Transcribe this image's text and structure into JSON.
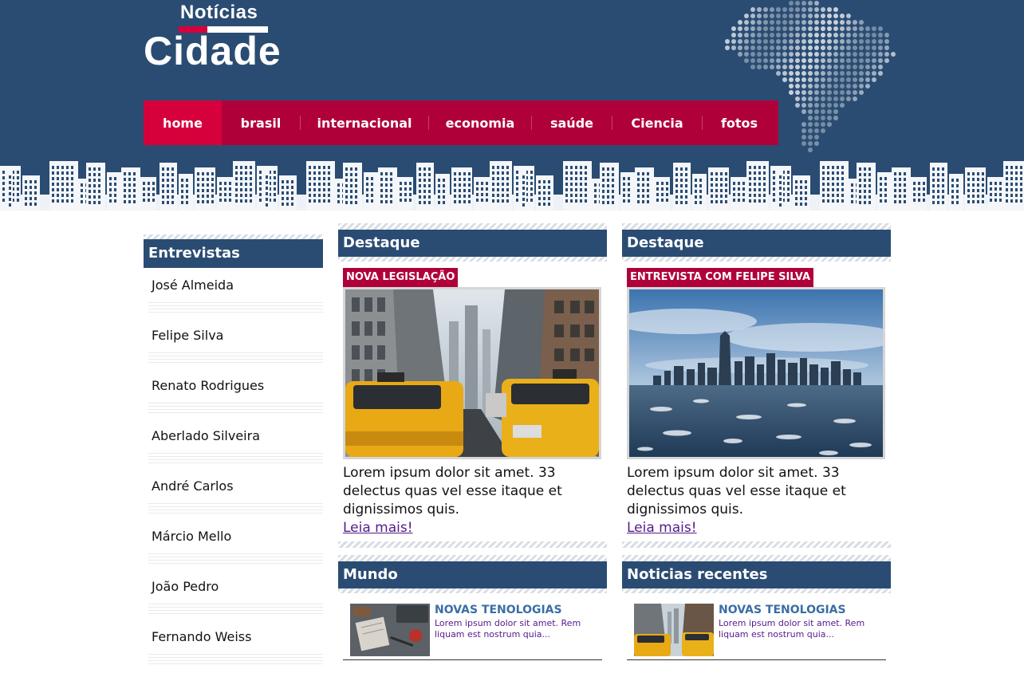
{
  "logo": {
    "top": "Notícias",
    "main": "Cidade"
  },
  "nav": [
    {
      "label": "home",
      "active": true
    },
    {
      "label": "brasil"
    },
    {
      "label": "internacional"
    },
    {
      "label": "economia"
    },
    {
      "label": "saúde"
    },
    {
      "label": "Ciencia"
    },
    {
      "label": "fotos"
    }
  ],
  "sidebar": {
    "title": "Entrevistas",
    "items": [
      "José Almeida",
      "Felipe Silva",
      "Renato Rodrigues",
      "Aberlado Silveira",
      "André Carlos",
      "Márcio Mello",
      "João Pedro",
      "Fernando Weiss"
    ]
  },
  "featured": [
    {
      "heading": "Destaque",
      "tag": "NOVA LEGISLAÇÃO",
      "text": "Lorem ipsum dolor sit amet. 33 delectus quas vel esse itaque et dignissimos quis.",
      "link": "Leia mais!"
    },
    {
      "heading": "Destaque",
      "tag": "ENTREVISTA COM FELIPE SILVA",
      "text": "Lorem ipsum dolor sit amet. 33 delectus quas vel esse itaque et dignissimos quis.",
      "link": "Leia mais!"
    }
  ],
  "mundo": {
    "heading": "Mundo",
    "item": {
      "title": "NOVAS TENOLOGIAS",
      "text": "Lorem ipsum dolor sit amet. Rem liquam est nostrum quia..."
    }
  },
  "recentes": {
    "heading": "Noticias recentes",
    "item": {
      "title": "NOVAS TENOLOGIAS",
      "text": "Lorem ipsum dolor sit amet. Rem liquam est nostrum quia..."
    }
  },
  "colors": {
    "navy": "#2a4c73",
    "crimson": "#b0003a",
    "active": "#d6003c",
    "link": "#551a8b",
    "mini_title": "#3a6ea5"
  }
}
